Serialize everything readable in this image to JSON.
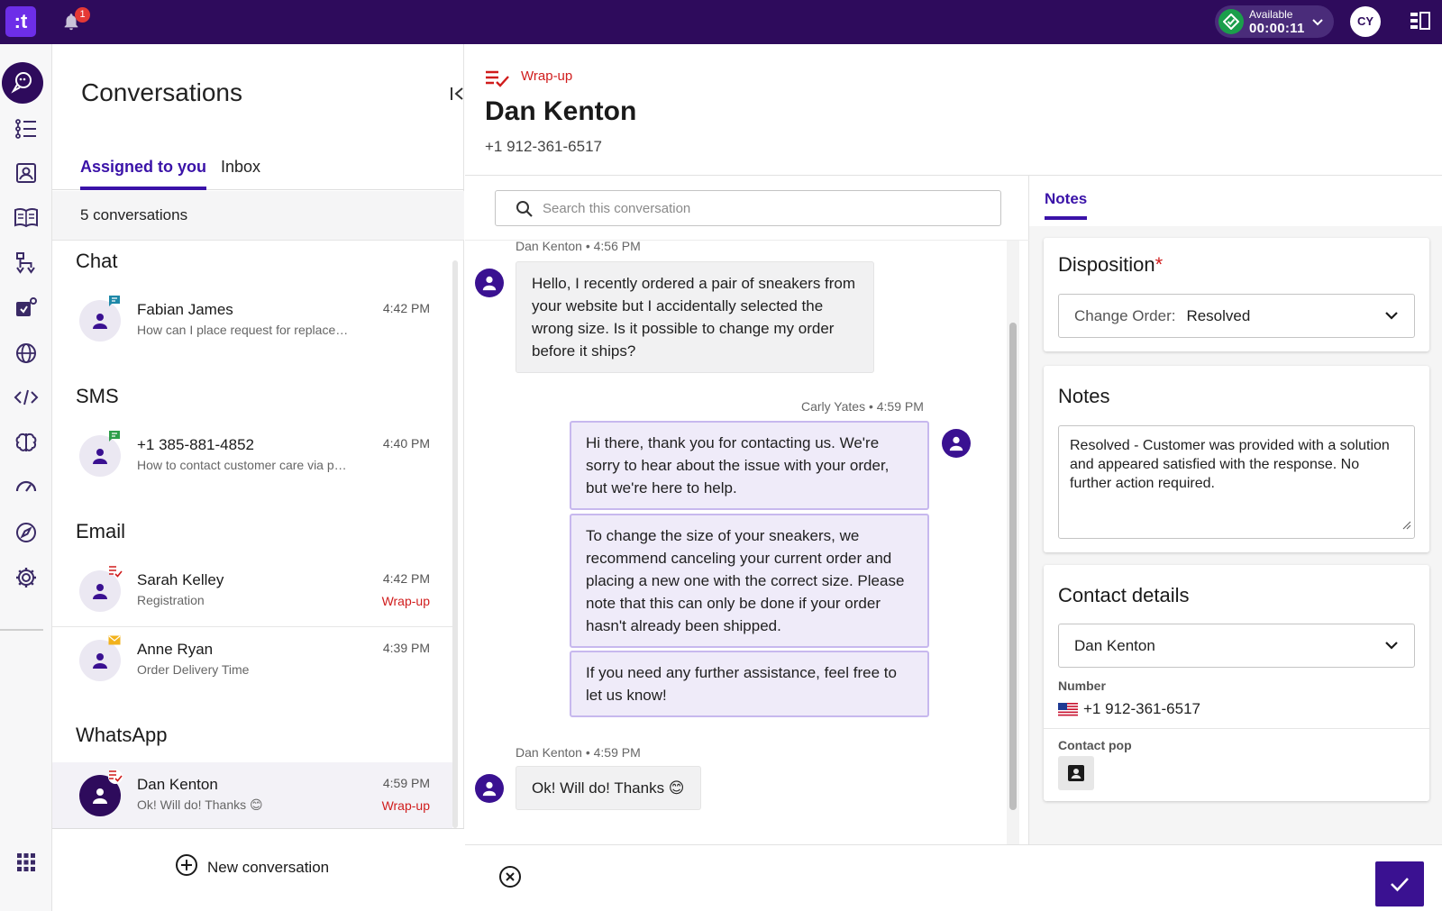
{
  "topbar": {
    "logo_text": ":t",
    "notification_count": "1",
    "status_label": "Available",
    "status_timer": "00:00:11",
    "user_initials": "CY"
  },
  "rail": {
    "icons": [
      "conversations-icon",
      "queue-list-icon",
      "contacts-icon",
      "knowledge-book-icon",
      "routing-flow-icon",
      "integrations-icon",
      "globe-icon",
      "code-icon",
      "ai-brain-icon",
      "dashboard-gauge-icon",
      "compass-icon",
      "settings-gear-icon",
      "apps-grid-icon"
    ]
  },
  "conversations": {
    "title": "Conversations",
    "tabs": [
      {
        "label": "Assigned to you",
        "active": true
      },
      {
        "label": "Inbox",
        "active": false
      }
    ],
    "count_text": "5 conversations",
    "sections": [
      {
        "title": "Chat",
        "items": [
          {
            "name": "Fabian James",
            "preview": "How can I place request for replacement?",
            "time": "4:42 PM",
            "status": "",
            "channel_icon": "chat-bubble-icon",
            "selected": false
          }
        ]
      },
      {
        "title": "SMS",
        "items": [
          {
            "name": "+1 385-881-4852",
            "preview": "How to contact customer care via phone?",
            "time": "4:40 PM",
            "status": "",
            "channel_icon": "sms-icon",
            "selected": false
          }
        ]
      },
      {
        "title": "Email",
        "items": [
          {
            "name": "Sarah Kelley",
            "preview": "Registration",
            "time": "4:42 PM",
            "status": "Wrap-up",
            "channel_icon": "wrapup-icon",
            "selected": false
          },
          {
            "name": "Anne Ryan",
            "preview": "Order Delivery Time",
            "time": "4:39 PM",
            "status": "",
            "channel_icon": "email-icon",
            "selected": false
          }
        ]
      },
      {
        "title": "WhatsApp",
        "items": [
          {
            "name": "Dan Kenton",
            "preview": "Ok! Will do! Thanks 😊",
            "time": "4:59 PM",
            "status": "Wrap-up",
            "channel_icon": "wrapup-icon",
            "selected": true
          }
        ]
      }
    ],
    "new_conversation_label": "New conversation"
  },
  "header": {
    "state_label": "Wrap-up",
    "contact_name": "Dan Kenton",
    "contact_phone": "+1 912-361-6517"
  },
  "chat": {
    "search_placeholder": "Search this conversation",
    "messages": [
      {
        "meta": "Dan Kenton • 4:56 PM",
        "direction": "in",
        "text": "Hello, I recently ordered a pair of sneakers from your website but I accidentally selected the wrong size. Is it possible to change my order before it ships?"
      },
      {
        "meta": "Carly Yates • 4:59 PM",
        "direction": "out",
        "text": "Hi there, thank you for contacting us. We're sorry to hear about the issue with your order, but we're here to help."
      },
      {
        "meta": "",
        "direction": "out",
        "text": "To change the size of your sneakers, we recommend canceling your current order and placing a new one with the correct size. Please note that this can only be done if your order hasn't already been shipped."
      },
      {
        "meta": "",
        "direction": "out",
        "text": "If you need any further assistance, feel free to let us know!"
      },
      {
        "meta": "Dan Kenton • 4:59 PM",
        "direction": "in",
        "text": "Ok! Will do! Thanks 😊"
      }
    ]
  },
  "panel": {
    "tab_label": "Notes",
    "disposition": {
      "title": "Disposition",
      "required_mark": "*",
      "select_label": "Change Order:",
      "select_value": "Resolved"
    },
    "notes": {
      "title": "Notes",
      "value": "Resolved - Customer was provided with a solution and appeared satisfied with the response. No further action required."
    },
    "contact_details": {
      "title": "Contact details",
      "selected_contact": "Dan Kenton",
      "number_label": "Number",
      "number_value": "+1 912-361-6517",
      "contact_pop_label": "Contact pop"
    }
  },
  "colors": {
    "brand_dark": "#2e0b5c",
    "accent": "#3a12a8",
    "wrapup_red": "#d01c1c",
    "available_green": "#1b9e4b"
  }
}
